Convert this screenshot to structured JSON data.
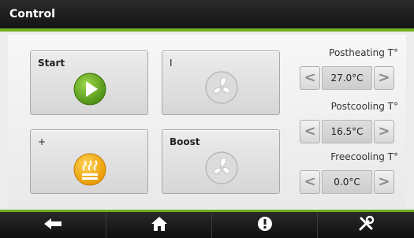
{
  "window": {
    "title": "Control"
  },
  "buttons": {
    "start": {
      "label": "Start",
      "icon": "play-icon",
      "color": "#5a9e1e"
    },
    "fan_1": {
      "label": "I",
      "icon": "fan-icon"
    },
    "heat": {
      "label": "+",
      "icon": "heating-icon",
      "color": "#f0a000"
    },
    "boost": {
      "label": "Boost",
      "icon": "fan-icon"
    }
  },
  "setpoints": [
    {
      "title": "Postheating T°",
      "value": "27.0°C",
      "dec": "<",
      "inc": ">"
    },
    {
      "title": "Postcooling T°",
      "value": "16.5°C",
      "dec": "<",
      "inc": ">"
    },
    {
      "title": "Freecooling T°",
      "value": "0.0°C",
      "dec": "<",
      "inc": ">"
    }
  ],
  "nav": [
    {
      "icon": "back-arrow-icon"
    },
    {
      "icon": "home-icon"
    },
    {
      "icon": "info-icon"
    },
    {
      "icon": "tools-icon"
    }
  ],
  "colors": {
    "accent": "#6fae1e",
    "bar": "#1a1a1a"
  }
}
